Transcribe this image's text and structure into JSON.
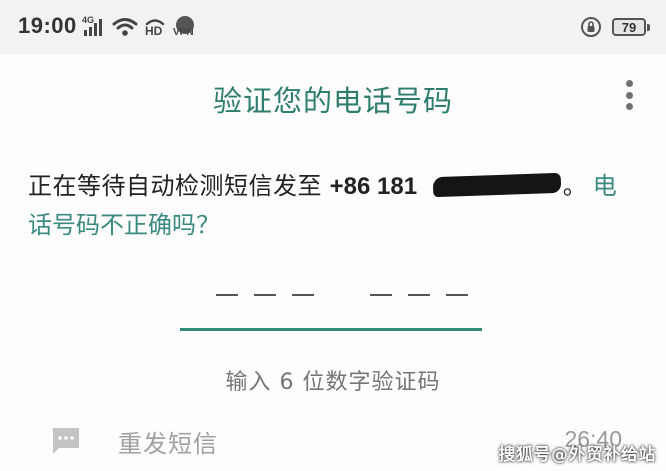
{
  "status_bar": {
    "time": "19:00",
    "network_type": "4G",
    "hd_label": "HD",
    "vpn_label": "VPN",
    "battery_level": "79"
  },
  "header": {
    "title": "验证您的电话号码",
    "menu_icon": "more-vert-icon"
  },
  "message": {
    "text": "正在等待自动检测短信发至",
    "phone_prefix": "+86 181",
    "period": "。",
    "wrong_number_link": "电话号码不正确吗？"
  },
  "code_entry": {
    "digits": 6,
    "hint": "输入 6 位数字验证码"
  },
  "resend": {
    "icon": "sms-icon",
    "label": "重发短信",
    "countdown": "26:40"
  },
  "watermark": "搜狐号@外贸补给站",
  "colors": {
    "accent": "#2f7d6e",
    "link": "#3a8a80",
    "status_bar_bg": "#f2f2f2",
    "muted_text": "#757575"
  }
}
